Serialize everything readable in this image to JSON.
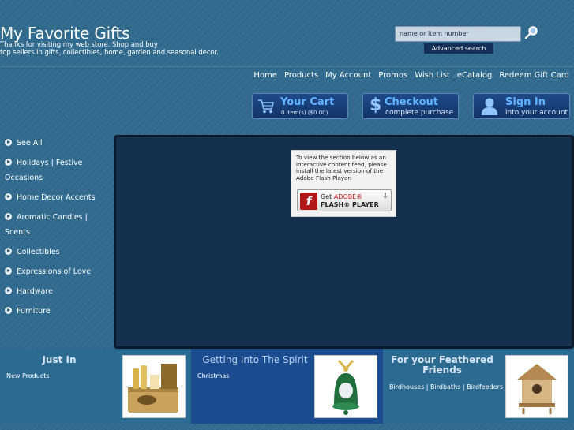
{
  "header": {
    "title": "My Favorite Gifts",
    "tagline_line1": "Thanks for visiting my web store. Shop and buy",
    "tagline_line2": "top sellers in gifts, collectibles, home, garden and seasonal decor.",
    "search_value": "name or item number",
    "advanced_search": "Advanced search"
  },
  "nav": {
    "items": [
      "Home",
      "Products",
      "My Account",
      "Promos",
      "Wish List",
      "eCatalog",
      "Redeem Gift Card"
    ]
  },
  "actions": {
    "cart_title": "Your Cart",
    "cart_sub": "0 item(s) ($0.00)",
    "checkout_title": "Checkout",
    "checkout_sub": "complete purchase",
    "signin_title": "Sign In",
    "signin_sub": "into your account"
  },
  "sidebar": {
    "items": [
      {
        "line1": "See All",
        "line2": ""
      },
      {
        "line1": "Holidays | Festive",
        "line2": "Occasions"
      },
      {
        "line1": "Home Decor Accents",
        "line2": ""
      },
      {
        "line1": "Aromatic Candles |",
        "line2": "Scents"
      },
      {
        "line1": "Collectibles",
        "line2": ""
      },
      {
        "line1": "Expressions of Love",
        "line2": ""
      },
      {
        "line1": "Hardware",
        "line2": ""
      },
      {
        "line1": "Furniture",
        "line2": ""
      }
    ]
  },
  "flash": {
    "message": "To view the section below as an interactive content feed, please install the latest version of the Adobe Flash Player.",
    "button_line1_a": "Get ",
    "button_line1_b": "ADOBE®",
    "button_line2": "FLASH® PLAYER"
  },
  "promos": [
    {
      "title": "Just In",
      "link": "New Products",
      "image_icon": "gift-basket-image"
    },
    {
      "title": "Getting Into The Spirit",
      "link": "Christmas",
      "image_icon": "bell-ornament-image"
    },
    {
      "title": "For your Feathered Friends",
      "link": "Birdhouses | Birdbaths | Birdfeeders",
      "image_icon": "birdhouse-image"
    }
  ],
  "colors": {
    "background": "#2e6a8e",
    "panel": "#14304f",
    "button_accent": "#5fb2ff",
    "promo_alt": "#1b4c90"
  }
}
